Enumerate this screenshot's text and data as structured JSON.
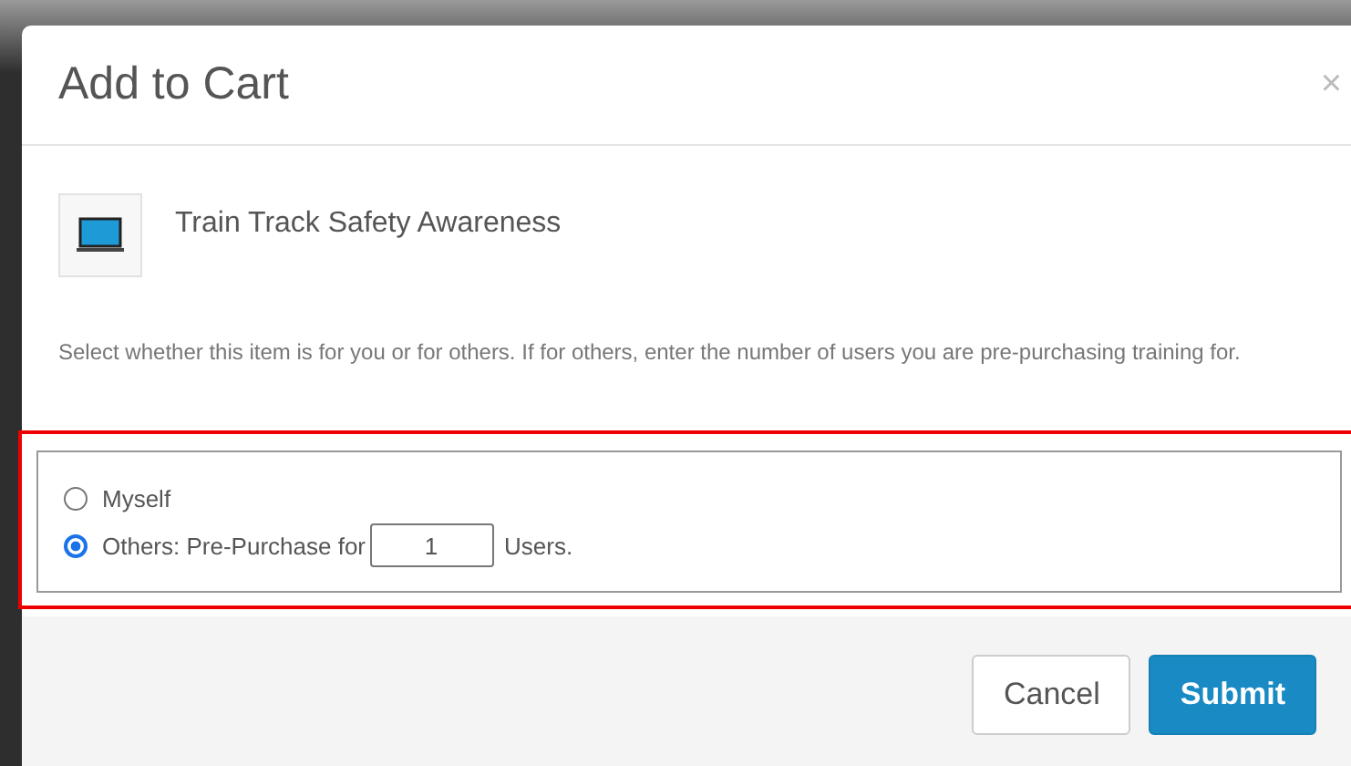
{
  "dialog": {
    "title": "Add to Cart",
    "close": "×"
  },
  "item": {
    "title": "Train Track Safety Awareness"
  },
  "description": "Select whether this item is for you or for others. If for others, enter the number of users you are pre-purchasing training for.",
  "options": [
    {
      "kind": "plain",
      "label": "Myself",
      "selected": false
    },
    {
      "kind": "count",
      "label": "Others: Pre-Purchase for",
      "selected": true,
      "value": "1",
      "suffix": "Users."
    }
  ],
  "buttons": [
    {
      "kind": "default",
      "label": "Cancel"
    },
    {
      "kind": "primary",
      "label": "Submit"
    }
  ]
}
